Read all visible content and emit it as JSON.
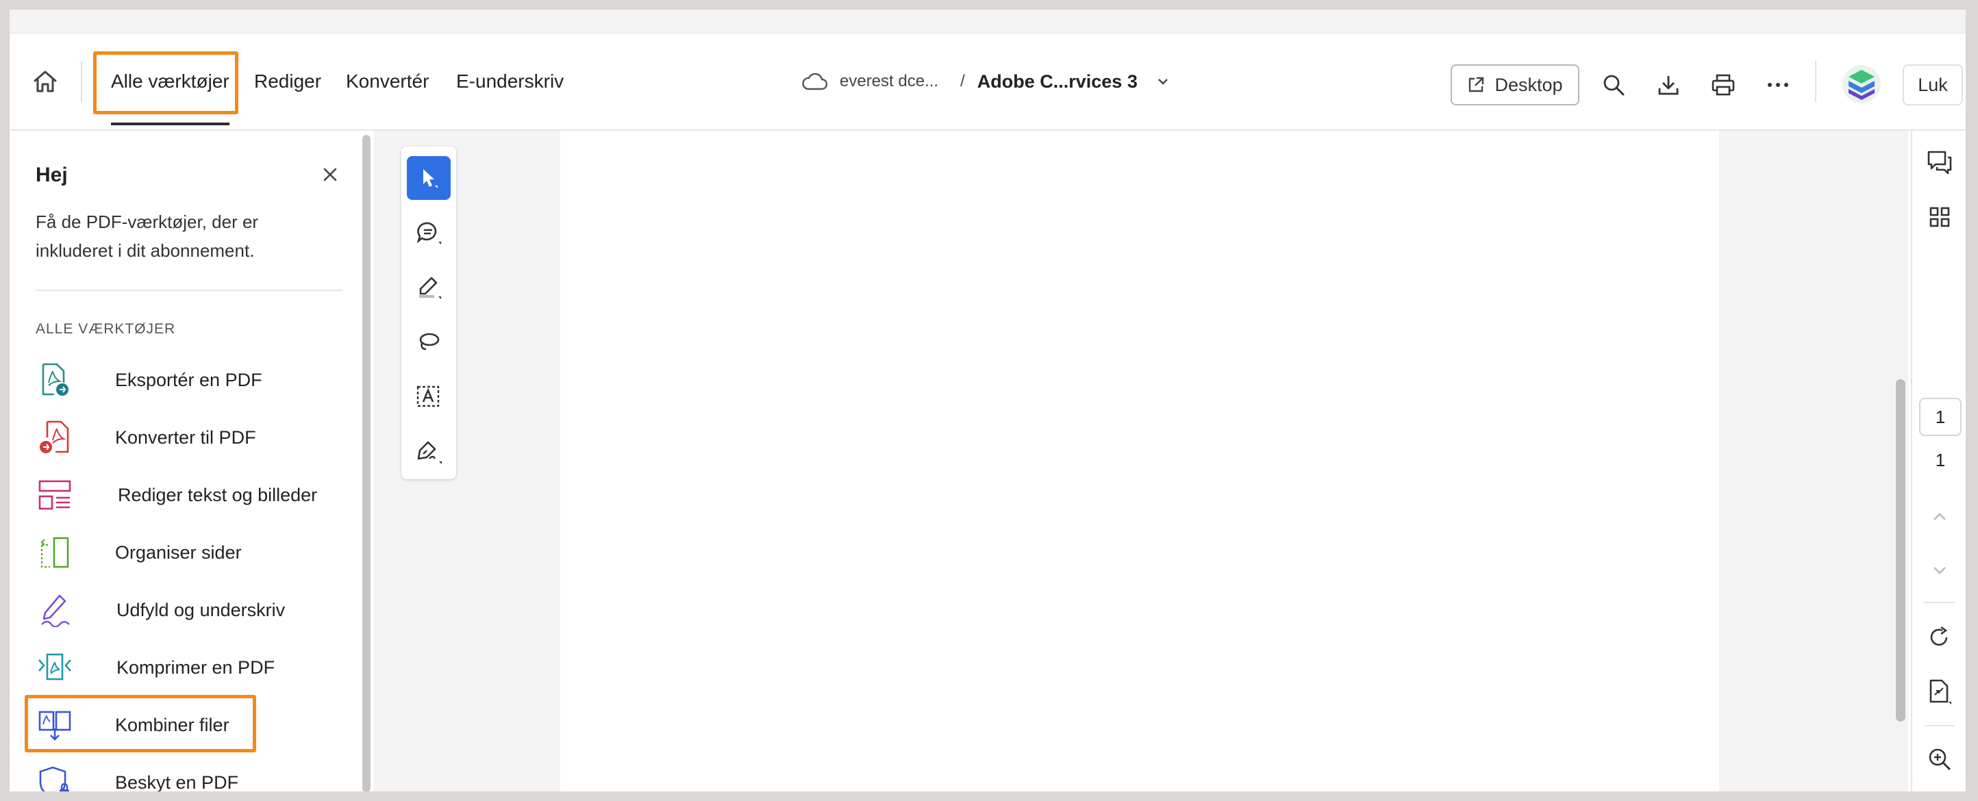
{
  "nav": {
    "tabs": [
      {
        "label": "Alle værktøjer",
        "active": true
      },
      {
        "label": "Rediger"
      },
      {
        "label": "Konvertér"
      },
      {
        "label": "E-underskriv"
      }
    ]
  },
  "breadcrumb": {
    "location": "everest dce...",
    "separator": "/",
    "document": "Adobe C...rvices 3"
  },
  "actions": {
    "desktop_label": "Desktop",
    "close_label": "Luk"
  },
  "panel": {
    "title": "Hej",
    "description": "Få de PDF-værktøjer, der er inkluderet i dit abonnement.",
    "section_label": "ALLE VÆRKTØJER",
    "tools": [
      {
        "label": "Eksportér en PDF",
        "icon": "export-pdf-icon",
        "color": "#2a8c86"
      },
      {
        "label": "Konverter til PDF",
        "icon": "convert-to-pdf-icon",
        "color": "#d33a3a"
      },
      {
        "label": "Rediger tekst og billeder",
        "icon": "edit-text-images-icon",
        "color": "#cc2e72"
      },
      {
        "label": "Organiser sider",
        "icon": "organize-pages-icon",
        "color": "#5aa52a"
      },
      {
        "label": "Udfyld og underskriv",
        "icon": "fill-sign-icon",
        "color": "#7a4fd6"
      },
      {
        "label": "Komprimer en PDF",
        "icon": "compress-pdf-icon",
        "color": "#1f9aa6"
      },
      {
        "label": "Kombiner filer",
        "icon": "combine-files-icon",
        "color": "#3a55d6"
      },
      {
        "label": "Beskyt en PDF",
        "icon": "protect-pdf-icon",
        "color": "#3a55d6"
      }
    ]
  },
  "page_nav": {
    "current": "1",
    "total": "1"
  },
  "colors": {
    "accent_blue": "#2f6fe4",
    "highlight_orange": "#f28a1c"
  }
}
